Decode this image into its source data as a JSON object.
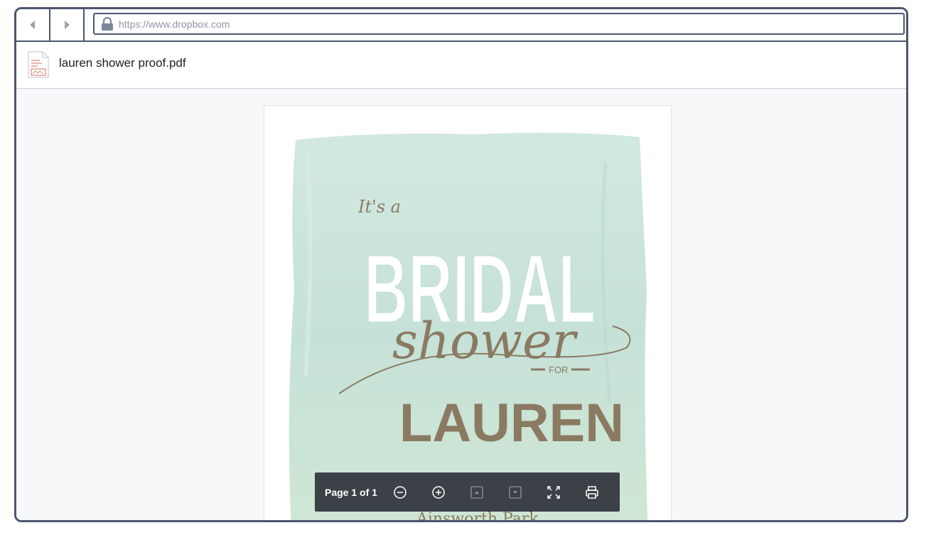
{
  "browser": {
    "url": "https://www.dropbox.com",
    "back_icon": "chevron-left-icon",
    "forward_icon": "chevron-right-icon",
    "lock_icon": "lock-icon"
  },
  "file": {
    "name": "lauren shower proof.pdf",
    "icon": "pdf-file-icon"
  },
  "document": {
    "line1": "It's a",
    "line2": "BRIDAL",
    "line3": "shower",
    "line4": "FOR",
    "line5": "LAUREN",
    "line6": "Ainsworth Park"
  },
  "pdf_toolbar": {
    "page_label": "Page 1 of 1",
    "buttons": [
      "zoom-out-icon",
      "zoom-in-icon",
      "page-up-icon",
      "page-down-icon",
      "fullscreen-icon",
      "print-icon"
    ]
  },
  "colors": {
    "frame": "#4c5570",
    "toolbar_bg": "#3b4147",
    "watercolor": "#c9e4dc",
    "accent_brown": "#8b7a62"
  }
}
